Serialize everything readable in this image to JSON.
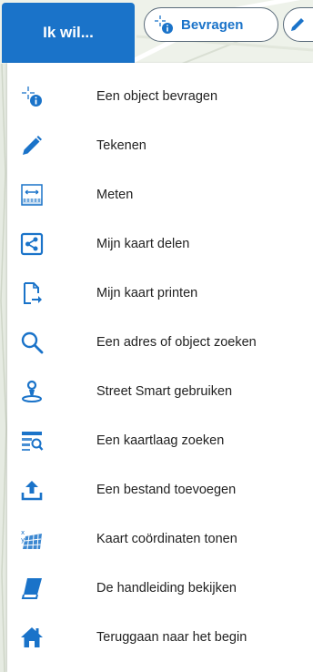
{
  "header": {
    "ik_wil_label": "Ik wil...",
    "bevragen_label": "Bevragen"
  },
  "colors": {
    "accent": "#1a73c9",
    "text": "#222222"
  },
  "menu": {
    "items": [
      {
        "label": "Een object bevragen",
        "icon": "info-crosshair-icon"
      },
      {
        "label": "Tekenen",
        "icon": "pencil-icon"
      },
      {
        "label": "Meten",
        "icon": "ruler-icon"
      },
      {
        "label": "Mijn kaart delen",
        "icon": "share-icon"
      },
      {
        "label": "Mijn kaart printen",
        "icon": "print-document-icon"
      },
      {
        "label": "Een adres of object zoeken",
        "icon": "search-icon"
      },
      {
        "label": "Street Smart gebruiken",
        "icon": "street-view-icon"
      },
      {
        "label": "Een kaartlaag zoeken",
        "icon": "layer-search-icon"
      },
      {
        "label": "Een bestand toevoegen",
        "icon": "upload-icon"
      },
      {
        "label": "Kaart coördinaten tonen",
        "icon": "map-coordinates-icon"
      },
      {
        "label": "De handleiding bekijken",
        "icon": "book-icon"
      },
      {
        "label": "Teruggaan naar het begin",
        "icon": "home-icon"
      }
    ]
  }
}
